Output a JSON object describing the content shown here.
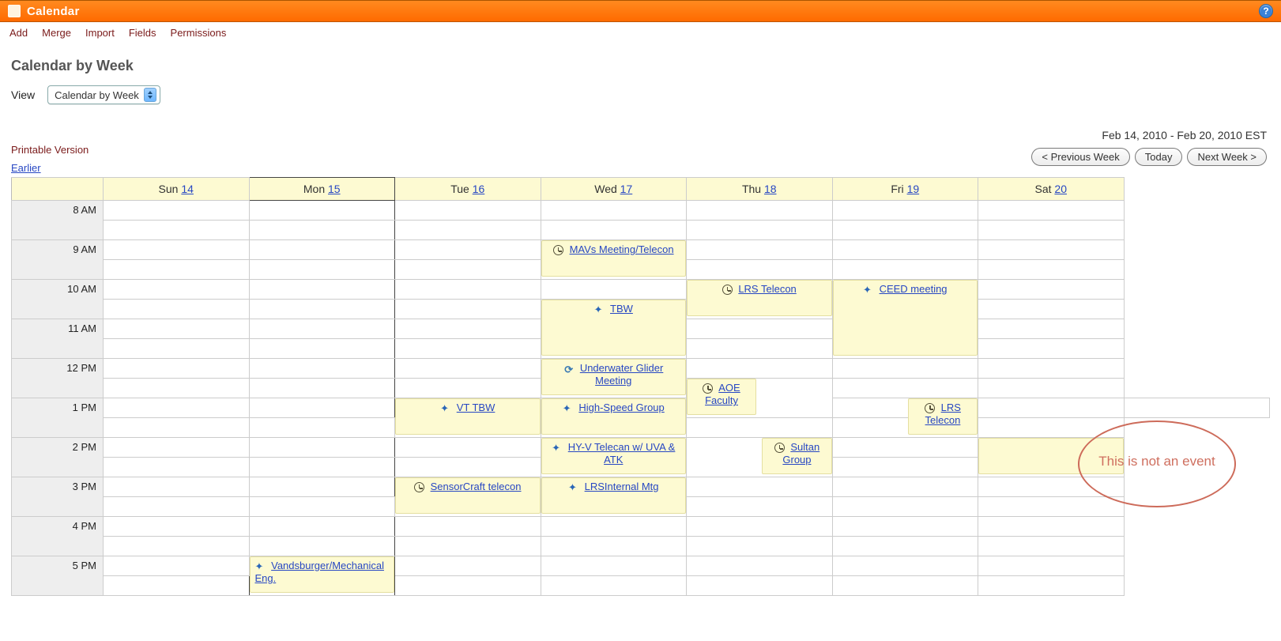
{
  "titlebar": {
    "title": "Calendar"
  },
  "menu": {
    "add": "Add",
    "merge": "Merge",
    "import": "Import",
    "fields": "Fields",
    "permissions": "Permissions"
  },
  "heading": "Calendar by Week",
  "view": {
    "label": "View",
    "selected": "Calendar by Week"
  },
  "date_range": "Feb 14, 2010 - Feb 20, 2010 EST",
  "nav": {
    "prev": "< Previous Week",
    "today": "Today",
    "next": "Next Week >"
  },
  "printable": "Printable Version",
  "earlier": "Earlier",
  "days": {
    "sun": {
      "label": "Sun",
      "num": "14"
    },
    "mon": {
      "label": "Mon",
      "num": "15"
    },
    "tue": {
      "label": "Tue",
      "num": "16"
    },
    "wed": {
      "label": "Wed",
      "num": "17"
    },
    "thu": {
      "label": "Thu",
      "num": "18"
    },
    "fri": {
      "label": "Fri",
      "num": "19"
    },
    "sat": {
      "label": "Sat",
      "num": "20"
    }
  },
  "hours": {
    "h8": "8 AM",
    "h9": "9 AM",
    "h10": "10 AM",
    "h11": "11 AM",
    "h12": "12 PM",
    "h13": "1 PM",
    "h14": "2 PM",
    "h15": "3 PM",
    "h16": "4 PM",
    "h17": "5 PM"
  },
  "events": {
    "mavs": "MAVs Meeting/Telecon",
    "lrs_thu10": "LRS Telecon",
    "ceed": "CEED meeting",
    "tbw": "TBW",
    "uw_glider": "Underwater Glider Meeting",
    "aoe": "AOE Faculty",
    "vt_tbw": "VT TBW",
    "hsg": "High-Speed Group",
    "lrs_thu13": "LRS Telecon",
    "hyv": "HY-V Telecan w/ UVA & ATK",
    "sultan": "Sultan Group",
    "sensorcraft": "SensorCraft telecon",
    "lrsint": "LRSInternal Mtg",
    "vands": "Vandsburger/Mechanical Eng."
  },
  "annotation": "This is not an event"
}
